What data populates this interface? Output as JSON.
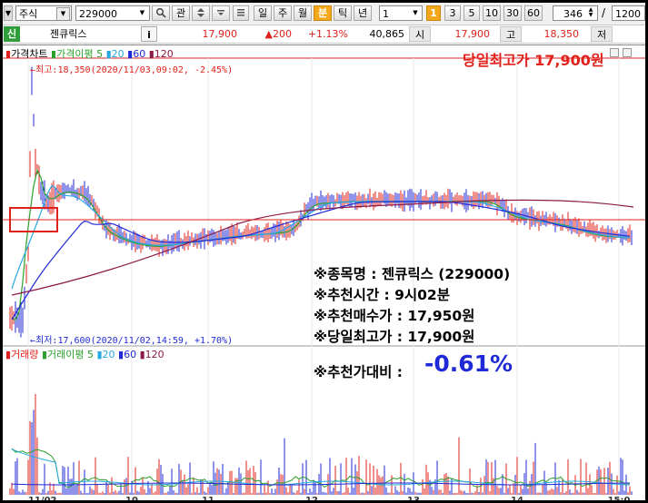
{
  "toolbar": {
    "market_type": "주식",
    "stock_code": "229000",
    "search_icon": "search-icon",
    "btn_kwan": "관",
    "period_buttons": [
      "일",
      "주",
      "월",
      "분",
      "틱",
      "년"
    ],
    "period_selected": "분",
    "interval_value": "1",
    "marker_one": "1",
    "interval_buttons": [
      "3",
      "5",
      "10",
      "30",
      "60"
    ],
    "count_value": "346",
    "count_separator": "/",
    "count_total": "1200"
  },
  "info": {
    "badge": "신",
    "stock_name": "젠큐릭스",
    "info_icon": "i",
    "current_price": "17,900",
    "change": "▲200",
    "change_pct": "+1.13%",
    "volume": "40,865",
    "open_label": "시",
    "open_value": "17,900",
    "high_label": "고",
    "high_value": "18,350",
    "low_label": "저"
  },
  "chart": {
    "price_legend": {
      "title": "가격차트",
      "ma_label": "가격이평",
      "periods": [
        "5",
        "20",
        "60",
        "120"
      ]
    },
    "volume_legend": {
      "title": "거래량",
      "ma_label": "거래이평",
      "periods": [
        "5",
        "20",
        "60",
        "120"
      ]
    },
    "high_annotation": "←최고:18,350(2020/11/03,09:02, -2.45%)",
    "low_annotation": "←최저:17,600(2020/11/02,14:59, +1.70%)",
    "headline": "당일최고가 17,900원",
    "notes": [
      "※종목명 : 젠큐릭스 (229000)",
      "※추천시간 : 9시02분",
      "※추천매수가 : 17,950원",
      "※당일최고가 : 17,900원",
      "※추천가대비 :"
    ],
    "return_pct": "-0.61%",
    "x_ticks": [
      "11/02",
      "10",
      "11",
      "12",
      "13",
      "14",
      "15:0"
    ],
    "colors": {
      "up": "#e0201a",
      "down": "#1f2ad6",
      "ma5": "#2ca02c",
      "ma20": "#28a8e0",
      "ma60": "#1f2ad6",
      "ma120": "#8b1a4a",
      "ref_line": "#e0201a"
    }
  }
}
